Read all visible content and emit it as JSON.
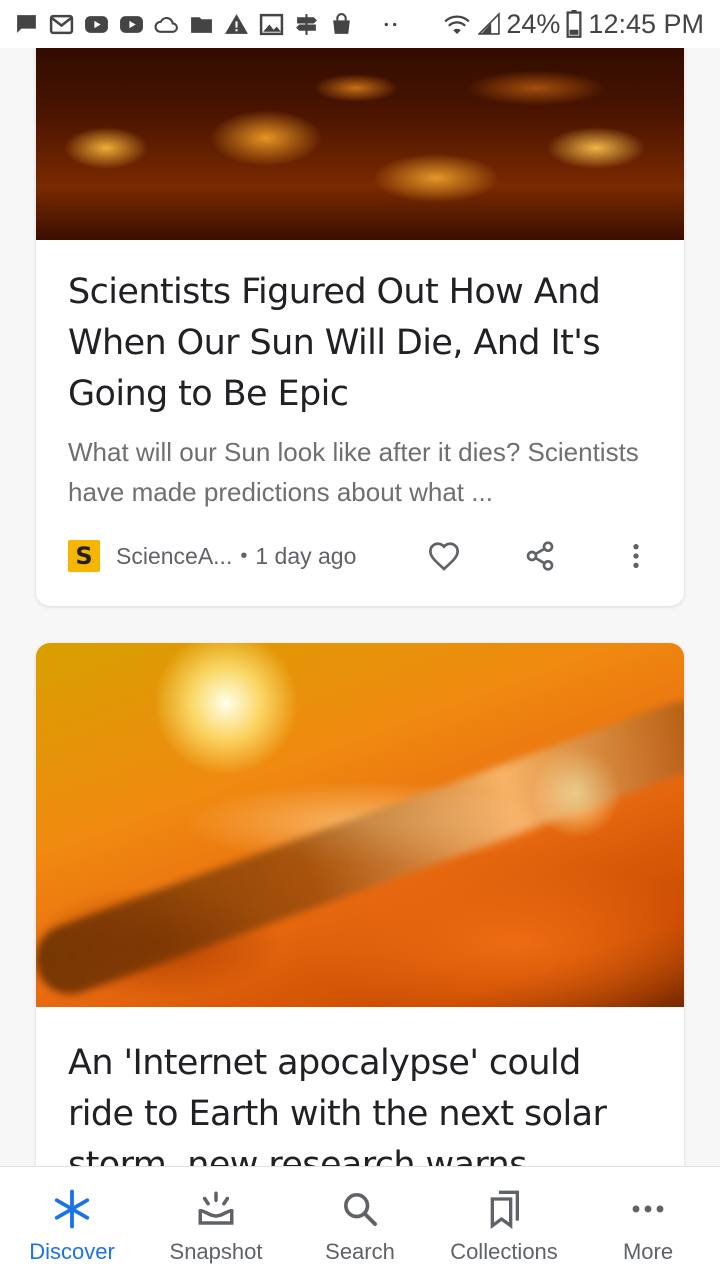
{
  "status_bar": {
    "battery": "24%",
    "time": "12:45 PM",
    "notification_icons": [
      "message-icon",
      "email-icon",
      "youtube-icon",
      "youtube-icon",
      "cloud-icon",
      "folder-icon",
      "warning-icon",
      "image-icon",
      "signpost-icon",
      "shopping-bag-icon",
      "more-dots-icon"
    ]
  },
  "articles": [
    {
      "headline": "Scientists Figured Out How And When Our Sun Will Die, And It's Going to Be Epic",
      "snippet": "What will our Sun look like after it dies? Scientists have made predictions about what ...",
      "source": "ScienceA...",
      "source_logo": "S",
      "time": "1 day ago"
    },
    {
      "headline": "An 'Internet apocalypse' could ride to Earth with the next solar storm, new research warns"
    }
  ],
  "bottom_nav": [
    {
      "label": "Discover",
      "active": true
    },
    {
      "label": "Snapshot"
    },
    {
      "label": "Search"
    },
    {
      "label": "Collections"
    },
    {
      "label": "More"
    }
  ],
  "colors": {
    "accent": "#1a73e8",
    "source_logo_bg": "#f6b500"
  }
}
